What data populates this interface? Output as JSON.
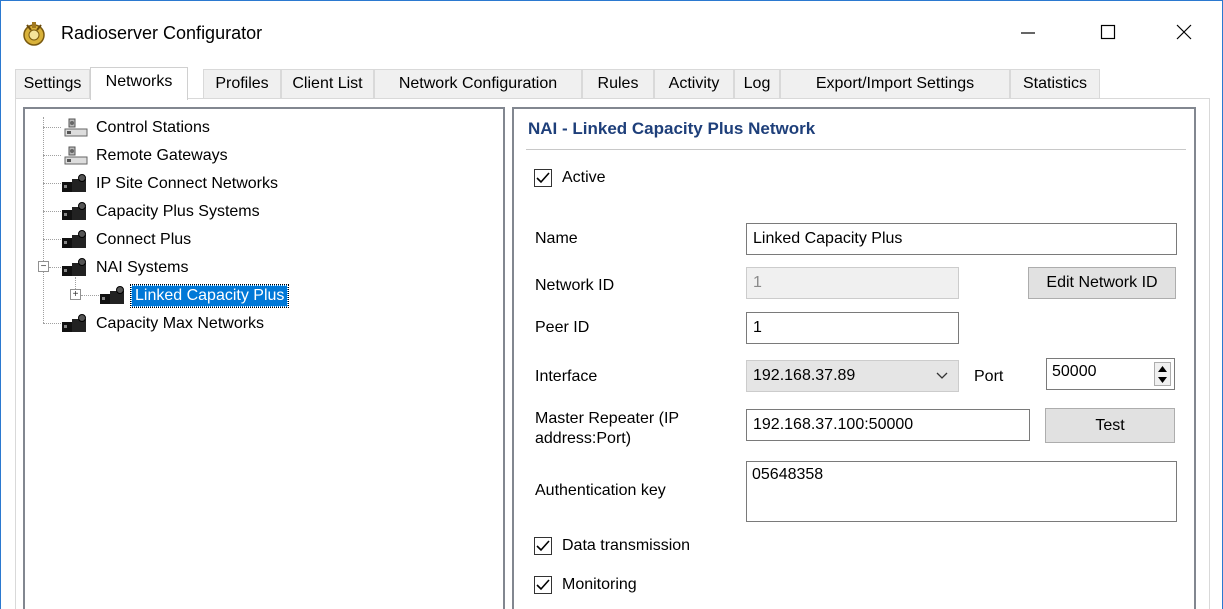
{
  "window": {
    "title": "Radioserver Configurator",
    "app_icon": "radioserver-app-icon",
    "controls": {
      "minimize_icon": "minimize-icon",
      "maximize_icon": "maximize-icon",
      "close_icon": "close-icon"
    }
  },
  "tabs": [
    {
      "label": "Settings"
    },
    {
      "label": "Networks",
      "active": true
    },
    {
      "label": "Profiles"
    },
    {
      "label": "Client List"
    },
    {
      "label": "Network Configuration"
    },
    {
      "label": "Rules"
    },
    {
      "label": "Activity"
    },
    {
      "label": "Log"
    },
    {
      "label": "Export/Import Settings"
    },
    {
      "label": "Statistics"
    }
  ],
  "tree": {
    "items": [
      {
        "label": "Control Stations",
        "icon": "control-station-icon"
      },
      {
        "label": "Remote Gateways",
        "icon": "remote-gateway-icon"
      },
      {
        "label": "IP Site Connect Networks",
        "icon": "network-icon"
      },
      {
        "label": "Capacity Plus Systems",
        "icon": "network-icon"
      },
      {
        "label": "Connect Plus",
        "icon": "network-icon"
      },
      {
        "label": "NAI Systems",
        "icon": "network-icon",
        "expanded": true
      },
      {
        "label": "Linked Capacity Plus",
        "icon": "network-icon",
        "selected": true,
        "collapsed": true
      },
      {
        "label": "Capacity Max Networks",
        "icon": "network-icon"
      }
    ]
  },
  "form": {
    "section_title": "NAI - Linked Capacity Plus Network",
    "active": {
      "label": "Active",
      "checked": true
    },
    "name": {
      "label": "Name",
      "value": "Linked Capacity Plus"
    },
    "network_id": {
      "label": "Network ID",
      "value": "1",
      "edit_button": "Edit Network ID"
    },
    "peer_id": {
      "label": "Peer ID",
      "value": "1"
    },
    "interface": {
      "label": "Interface",
      "value": "192.168.37.89",
      "port_label": "Port",
      "port_value": "50000"
    },
    "master_repeater": {
      "label": "Master Repeater (IP address:Port)",
      "value": "192.168.37.100:50000",
      "test_button": "Test"
    },
    "auth_key": {
      "label": "Authentication key",
      "value": "05648358"
    },
    "data_transmission": {
      "label": "Data transmission",
      "checked": true
    },
    "monitoring": {
      "label": "Monitoring",
      "checked": true
    }
  },
  "colors": {
    "selection": "#0078d7",
    "section_title": "#1e3f7a",
    "window_border": "#2b79d0"
  }
}
